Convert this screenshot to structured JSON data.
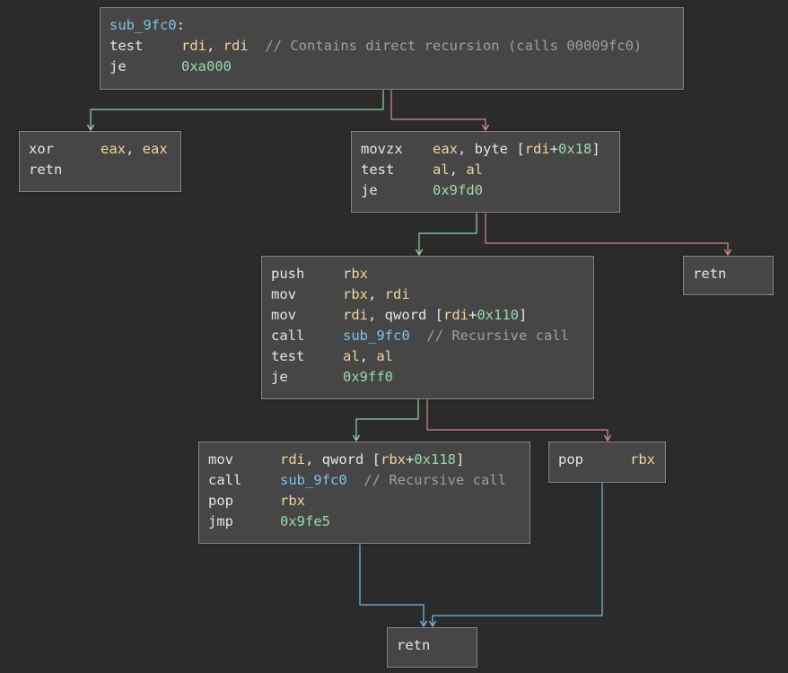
{
  "colors": {
    "background": "#2b2b2b",
    "block_fill": "#464646",
    "block_border": "#868686",
    "edge_true": "#98d1a6",
    "edge_false": "#d58a8a",
    "edge_flow": "#79b8e0"
  },
  "blocks": {
    "entry": {
      "label": "sub_9fc0",
      "label_colon": ":",
      "l1": {
        "mn": "test",
        "a": "rdi",
        "s1": ", ",
        "b": "rdi",
        "cmt": "  // Contains direct recursion (calls 00009fc0)"
      },
      "l2": {
        "mn": "je",
        "a": "0xa000"
      }
    },
    "ret_zero": {
      "l1": {
        "mn": "xor",
        "a": "eax",
        "s1": ", ",
        "b": "eax"
      },
      "l2": {
        "mn": "retn"
      }
    },
    "check_flag": {
      "l1": {
        "mn": "movzx",
        "a": "eax",
        "s1": ", byte [",
        "b": "rdi",
        "s2": "+",
        "c": "0x18",
        "s3": "]"
      },
      "l2": {
        "mn": "test",
        "a": "al",
        "s1": ", ",
        "b": "al"
      },
      "l3": {
        "mn": "je",
        "a": "0x9fd0"
      }
    },
    "ret_early": {
      "l1": {
        "mn": "retn"
      }
    },
    "recurse_left": {
      "l1": {
        "mn": "push",
        "a": "rbx"
      },
      "l2": {
        "mn": "mov",
        "a": "rbx",
        "s1": ", ",
        "b": "rdi"
      },
      "l3": {
        "mn": "mov",
        "a": "rdi",
        "s1": ", qword [",
        "b": "rdi",
        "s2": "+",
        "c": "0x110",
        "s3": "]"
      },
      "l4": {
        "mn": "call",
        "a": "sub_9fc0",
        "cmt": "  // Recursive call"
      },
      "l5": {
        "mn": "test",
        "a": "al",
        "s1": ", ",
        "b": "al"
      },
      "l6": {
        "mn": "je",
        "a": "0x9ff0"
      }
    },
    "recurse_right": {
      "l1": {
        "mn": "mov",
        "a": "rdi",
        "s1": ", qword [",
        "b": "rbx",
        "s2": "+",
        "c": "0x118",
        "s3": "]"
      },
      "l2": {
        "mn": "call",
        "a": "sub_9fc0",
        "cmt": "  // Recursive call"
      },
      "l3": {
        "mn": "pop",
        "a": "rbx"
      },
      "l4": {
        "mn": "jmp",
        "a": "0x9fe5"
      }
    },
    "pop_rbx": {
      "l1": {
        "mn": "pop",
        "a": "rbx"
      }
    },
    "ret_final": {
      "l1": {
        "mn": "retn"
      }
    }
  }
}
